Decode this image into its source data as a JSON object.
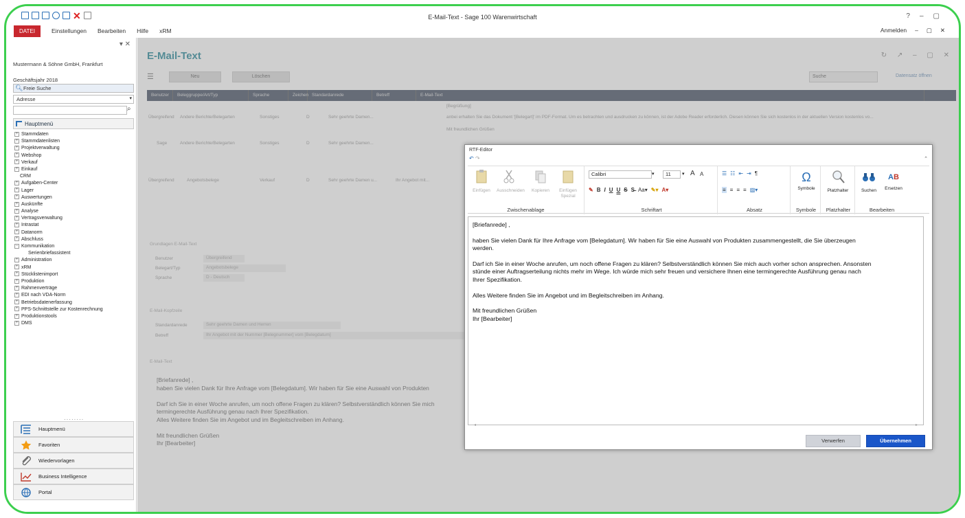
{
  "window": {
    "title": "E-Mail-Text - Sage 100 Warenwirtschaft",
    "controls": [
      "?",
      "–",
      "▢"
    ]
  },
  "menu": {
    "datei": "DATEI",
    "items": [
      "Einstellungen",
      "Bearbeiten",
      "Hilfe",
      "xRM"
    ],
    "right": [
      "Anmelden",
      "–",
      "▢",
      "✕"
    ]
  },
  "left": {
    "company": "Mustermann & Söhne GmbH, Frankfurt",
    "fiscal_year": "Geschäftsjahr 2018",
    "search_label": "Freie Suche",
    "select_value": "Adresse",
    "tree_header": "Hauptmenü",
    "tree": [
      {
        "label": "Stammdaten",
        "type": "node"
      },
      {
        "label": "Stammdatenlisten",
        "type": "node"
      },
      {
        "label": "Projektverwaltung",
        "type": "node"
      },
      {
        "label": "Webshop",
        "type": "node"
      },
      {
        "label": "Verkauf",
        "type": "node"
      },
      {
        "label": "Einkauf",
        "type": "node"
      },
      {
        "label": "CRM",
        "type": "leaf"
      },
      {
        "label": "Aufgaben-Center",
        "type": "node"
      },
      {
        "label": "Lager",
        "type": "node"
      },
      {
        "label": "Auswertungen",
        "type": "node"
      },
      {
        "label": "Auskünfte",
        "type": "node"
      },
      {
        "label": "Analyse",
        "type": "node"
      },
      {
        "label": "Vertragsverwaltung",
        "type": "node"
      },
      {
        "label": "Intrastat",
        "type": "node"
      },
      {
        "label": "Datanorm",
        "type": "node"
      },
      {
        "label": "Abschluss",
        "type": "node"
      },
      {
        "label": "Kommunikation",
        "type": "open"
      },
      {
        "label": "Serienbriefassistent",
        "type": "sub"
      },
      {
        "label": "Administration",
        "type": "node"
      },
      {
        "label": "xRM",
        "type": "node"
      },
      {
        "label": "Stücklistenimport",
        "type": "node"
      },
      {
        "label": "Produktion",
        "type": "node"
      },
      {
        "label": "Rahmenverträge",
        "type": "node"
      },
      {
        "label": "EDI nach VDA-Norm",
        "type": "node"
      },
      {
        "label": "Betriebsdatenerfassung",
        "type": "node"
      },
      {
        "label": "PPS-Schnittstelle zur Kostenrechnung",
        "type": "node"
      },
      {
        "label": "Produktionstools",
        "type": "node"
      },
      {
        "label": "DMS",
        "type": "node"
      }
    ],
    "grip": "········",
    "nav_buttons": [
      "Hauptmenü",
      "Favoriten",
      "Wiedervorlagen",
      "Business Intelligence",
      "Portal"
    ]
  },
  "doc": {
    "title": "E-Mail-Text",
    "tool_new": "Neu",
    "tool_delete": "Löschen",
    "search_placeholder": "Suche",
    "dataset_label": "Datensatz öffnen",
    "columns": [
      "Benutzer",
      "Beleggruppe/Art/Typ",
      "Sprache",
      "Zeichen",
      "Standardanrede",
      "Betreff",
      "E-Mail-Text"
    ],
    "row1_mail_top": "[Begrüßung]",
    "row1": [
      "Übergreifend",
      "Andere Berichte/Belegarten",
      "Sonstiges",
      "D",
      "Sehr geehrte Damen...",
      "",
      "anbei erhalten Sie das Dokument '[Belegart]' im PDF-Format. Um es betrachten und ausdrucken zu können, ist der Adobe Reader erforderlich. Diesen können Sie sich kostenlos in der aktuellen Version kostenlos vo..."
    ],
    "row1_greeting": "Mit freundlichen Grüßen",
    "row2": [
      "Sage",
      "Andere Berichte/Belegarten",
      "Sonstiges",
      "D",
      "Sehr geehrte Damen..."
    ],
    "row3": [
      "Übergreifend",
      "Angebotsbelege",
      "Verkauf",
      "D",
      "Sehr geehrte Damen u...",
      "Ihr Angebot mit..."
    ],
    "section_general": "Grundlagen E-Mail-Text",
    "prop_user": "Benutzer",
    "prop_user_val": "Übergreifend",
    "prop_type": "Belegart/Typ",
    "prop_type_val": "Angebotsbelege",
    "prop_lang": "Sprache",
    "prop_lang_val": "D - Deutsch",
    "section_mail": "E-Mail-Kopfzeile",
    "prop_salutation": "Standardanrede",
    "prop_salutation_val": "Sehr geehrte Damen und Herren",
    "prop_subject": "Betreff",
    "prop_subject_val": "Ihr Angebot mit der Nummer [Belegnummer] vom [Belegdatum]",
    "section_text": "E-Mail-Text",
    "text": "[Briefanrede] ,\nhaben Sie vielen Dank für Ihre Anfrage vom [Belegdatum]. Wir haben für Sie eine Auswahl von Produkten\n\nDarf ich Sie in einer Woche anrufen, um noch offene Fragen zu klären? Selbstverständlich können Sie mich\ntermingerechte Ausführung genau nach Ihrer Spezifikation.\nAlles Weitere finden Sie im Angebot und im Begleitschreiben im Anhang.\n\nMit freundlichen Grüßen\nIhr [Bearbeiter]"
  },
  "dialog": {
    "title": "RTF-Editor",
    "groups": {
      "clipboard": "Zwischenablage",
      "font": "Schriftart",
      "paragraph": "Absatz",
      "symbols": "Symbole",
      "placeholder": "Platzhalter",
      "edit": "Bearbeiten"
    },
    "clipboard_buttons": [
      "Einfügen",
      "Ausschneiden",
      "Kopieren",
      "Einfügen Spezial"
    ],
    "font_name": "Calibri",
    "font_size": "11",
    "symbols_btn": "Symbole",
    "placeholder_btn": "Platzhalter",
    "search_btn": "Suchen",
    "replace_btn": "Ersetzen",
    "content": "[Briefanrede] ,\n\nhaben Sie vielen Dank für Ihre Anfrage vom [Belegdatum]. Wir haben für Sie eine Auswahl von Produkten zusammengestellt, die Sie überzeugen\nwerden.\n\nDarf ich Sie in einer Woche anrufen, um noch offene Fragen zu klären? Selbstverständlich können Sie mich auch vorher schon ansprechen. Ansonsten\nstünde einer Auftragserteilung nichts mehr im Wege. Ich würde mich sehr freuen und versichere Ihnen eine termingerechte Ausführung genau nach\nIhrer Spezifikation.\n\nAlles Weitere finden Sie im Angebot und im Begleitschreiben im Anhang.\n\nMit freundlichen Grüßen\nIhr [Bearbeiter]",
    "discard": "Verwerfen",
    "apply": "Übernehmen"
  }
}
